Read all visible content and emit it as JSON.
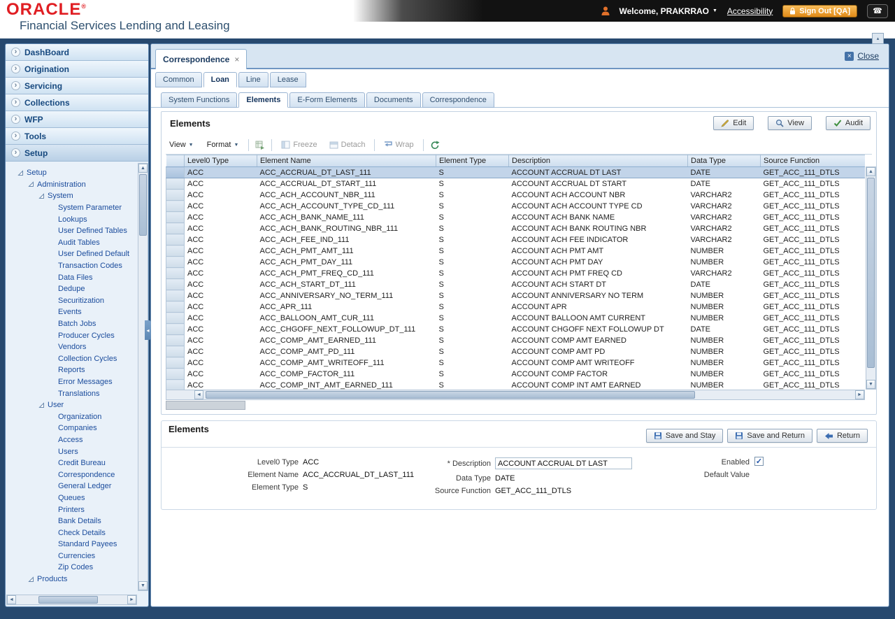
{
  "header": {
    "logo": "ORACLE",
    "logo_reg": "®",
    "product": "Financial Services Lending and Leasing",
    "welcome": "Welcome, PRAKRRAO",
    "accessibility": "Accessibility",
    "sign_out": "Sign Out [QA]"
  },
  "icons": {
    "caret_down": "▼",
    "chevron_right": "›",
    "close_x": "×",
    "phone": "☎",
    "check": "✓",
    "scroll_up": "▲",
    "scroll_down": "▼",
    "scroll_left": "◄",
    "scroll_right": "►",
    "collapse_left": "◂",
    "collapse_up": "▴"
  },
  "sidebar": {
    "nav": [
      {
        "label": "DashBoard",
        "selected": false
      },
      {
        "label": "Origination",
        "selected": false
      },
      {
        "label": "Servicing",
        "selected": false
      },
      {
        "label": "Collections",
        "selected": false
      },
      {
        "label": "WFP",
        "selected": false
      },
      {
        "label": "Tools",
        "selected": false
      },
      {
        "label": "Setup",
        "selected": true
      }
    ],
    "tree": [
      {
        "label": "Setup",
        "indent": 0,
        "expanded": true
      },
      {
        "label": "Administration",
        "indent": 1,
        "expanded": true
      },
      {
        "label": "System",
        "indent": 2,
        "expanded": true
      },
      {
        "label": "System Parameter",
        "indent": 3,
        "expanded": false
      },
      {
        "label": "Lookups",
        "indent": 3,
        "expanded": false
      },
      {
        "label": "User Defined Tables",
        "indent": 3,
        "expanded": false
      },
      {
        "label": "Audit Tables",
        "indent": 3,
        "expanded": false
      },
      {
        "label": "User Defined Default",
        "indent": 3,
        "expanded": false
      },
      {
        "label": "Transaction Codes",
        "indent": 3,
        "expanded": false
      },
      {
        "label": "Data Files",
        "indent": 3,
        "expanded": false
      },
      {
        "label": "Dedupe",
        "indent": 3,
        "expanded": false
      },
      {
        "label": "Securitization",
        "indent": 3,
        "expanded": false
      },
      {
        "label": "Events",
        "indent": 3,
        "expanded": false
      },
      {
        "label": "Batch Jobs",
        "indent": 3,
        "expanded": false
      },
      {
        "label": "Producer Cycles",
        "indent": 3,
        "expanded": false
      },
      {
        "label": "Vendors",
        "indent": 3,
        "expanded": false
      },
      {
        "label": "Collection Cycles",
        "indent": 3,
        "expanded": false
      },
      {
        "label": "Reports",
        "indent": 3,
        "expanded": false
      },
      {
        "label": "Error Messages",
        "indent": 3,
        "expanded": false
      },
      {
        "label": "Translations",
        "indent": 3,
        "expanded": false
      },
      {
        "label": "User",
        "indent": 2,
        "expanded": true
      },
      {
        "label": "Organization",
        "indent": 3,
        "expanded": false
      },
      {
        "label": "Companies",
        "indent": 3,
        "expanded": false
      },
      {
        "label": "Access",
        "indent": 3,
        "expanded": false
      },
      {
        "label": "Users",
        "indent": 3,
        "expanded": false
      },
      {
        "label": "Credit Bureau",
        "indent": 3,
        "expanded": false
      },
      {
        "label": "Correspondence",
        "indent": 3,
        "expanded": false
      },
      {
        "label": "General Ledger",
        "indent": 3,
        "expanded": false
      },
      {
        "label": "Queues",
        "indent": 3,
        "expanded": false
      },
      {
        "label": "Printers",
        "indent": 3,
        "expanded": false
      },
      {
        "label": "Bank Details",
        "indent": 3,
        "expanded": false
      },
      {
        "label": "Check Details",
        "indent": 3,
        "expanded": false
      },
      {
        "label": "Standard Payees",
        "indent": 3,
        "expanded": false
      },
      {
        "label": "Currencies",
        "indent": 3,
        "expanded": false
      },
      {
        "label": "Zip Codes",
        "indent": 3,
        "expanded": false
      },
      {
        "label": "Products",
        "indent": 1,
        "expanded": true
      }
    ]
  },
  "workspace": {
    "doc_tab": "Correspondence",
    "close_label": "Close",
    "tabs_level1": [
      {
        "label": "Common",
        "active": false
      },
      {
        "label": "Loan",
        "active": true
      },
      {
        "label": "Line",
        "active": false
      },
      {
        "label": "Lease",
        "active": false
      }
    ],
    "tabs_level2": [
      {
        "label": "System Functions",
        "active": false
      },
      {
        "label": "Elements",
        "active": true
      },
      {
        "label": "E-Form Elements",
        "active": false
      },
      {
        "label": "Documents",
        "active": false
      },
      {
        "label": "Correspondence",
        "active": false
      }
    ]
  },
  "elements_panel": {
    "title": "Elements",
    "actions": {
      "edit": "Edit",
      "view": "View",
      "audit": "Audit"
    },
    "toolbar": {
      "view": "View",
      "format": "Format",
      "freeze": "Freeze",
      "detach": "Detach",
      "wrap": "Wrap"
    },
    "table": {
      "columns": [
        "Level0 Type",
        "Element Name",
        "Element Type",
        "Description",
        "Data Type",
        "Source Function"
      ],
      "selected_row": 0,
      "rows": [
        [
          "ACC",
          "ACC_ACCRUAL_DT_LAST_111",
          "S",
          "ACCOUNT ACCRUAL DT LAST",
          "DATE",
          "GET_ACC_111_DTLS"
        ],
        [
          "ACC",
          "ACC_ACCRUAL_DT_START_111",
          "S",
          "ACCOUNT ACCRUAL DT START",
          "DATE",
          "GET_ACC_111_DTLS"
        ],
        [
          "ACC",
          "ACC_ACH_ACCOUNT_NBR_111",
          "S",
          "ACCOUNT ACH ACCOUNT NBR",
          "VARCHAR2",
          "GET_ACC_111_DTLS"
        ],
        [
          "ACC",
          "ACC_ACH_ACCOUNT_TYPE_CD_111",
          "S",
          "ACCOUNT ACH ACCOUNT TYPE CD",
          "VARCHAR2",
          "GET_ACC_111_DTLS"
        ],
        [
          "ACC",
          "ACC_ACH_BANK_NAME_111",
          "S",
          "ACCOUNT ACH BANK NAME",
          "VARCHAR2",
          "GET_ACC_111_DTLS"
        ],
        [
          "ACC",
          "ACC_ACH_BANK_ROUTING_NBR_111",
          "S",
          "ACCOUNT ACH BANK ROUTING NBR",
          "VARCHAR2",
          "GET_ACC_111_DTLS"
        ],
        [
          "ACC",
          "ACC_ACH_FEE_IND_111",
          "S",
          "ACCOUNT ACH FEE INDICATOR",
          "VARCHAR2",
          "GET_ACC_111_DTLS"
        ],
        [
          "ACC",
          "ACC_ACH_PMT_AMT_111",
          "S",
          "ACCOUNT ACH PMT AMT",
          "NUMBER",
          "GET_ACC_111_DTLS"
        ],
        [
          "ACC",
          "ACC_ACH_PMT_DAY_111",
          "S",
          "ACCOUNT ACH PMT DAY",
          "NUMBER",
          "GET_ACC_111_DTLS"
        ],
        [
          "ACC",
          "ACC_ACH_PMT_FREQ_CD_111",
          "S",
          "ACCOUNT ACH PMT FREQ CD",
          "VARCHAR2",
          "GET_ACC_111_DTLS"
        ],
        [
          "ACC",
          "ACC_ACH_START_DT_111",
          "S",
          "ACCOUNT ACH START DT",
          "DATE",
          "GET_ACC_111_DTLS"
        ],
        [
          "ACC",
          "ACC_ANNIVERSARY_NO_TERM_111",
          "S",
          "ACCOUNT ANNIVERSARY NO TERM",
          "NUMBER",
          "GET_ACC_111_DTLS"
        ],
        [
          "ACC",
          "ACC_APR_111",
          "S",
          "ACCOUNT APR",
          "NUMBER",
          "GET_ACC_111_DTLS"
        ],
        [
          "ACC",
          "ACC_BALLOON_AMT_CUR_111",
          "S",
          "ACCOUNT BALLOON AMT CURRENT",
          "NUMBER",
          "GET_ACC_111_DTLS"
        ],
        [
          "ACC",
          "ACC_CHGOFF_NEXT_FOLLOWUP_DT_111",
          "S",
          "ACCOUNT CHGOFF NEXT FOLLOWUP DT",
          "DATE",
          "GET_ACC_111_DTLS"
        ],
        [
          "ACC",
          "ACC_COMP_AMT_EARNED_111",
          "S",
          "ACCOUNT COMP AMT EARNED",
          "NUMBER",
          "GET_ACC_111_DTLS"
        ],
        [
          "ACC",
          "ACC_COMP_AMT_PD_111",
          "S",
          "ACCOUNT COMP AMT PD",
          "NUMBER",
          "GET_ACC_111_DTLS"
        ],
        [
          "ACC",
          "ACC_COMP_AMT_WRITEOFF_111",
          "S",
          "ACCOUNT COMP AMT WRITEOFF",
          "NUMBER",
          "GET_ACC_111_DTLS"
        ],
        [
          "ACC",
          "ACC_COMP_FACTOR_111",
          "S",
          "ACCOUNT COMP FACTOR",
          "NUMBER",
          "GET_ACC_111_DTLS"
        ],
        [
          "ACC",
          "ACC_COMP_INT_AMT_EARNED_111",
          "S",
          "ACCOUNT COMP INT AMT EARNED",
          "NUMBER",
          "GET_ACC_111_DTLS"
        ]
      ]
    }
  },
  "detail_panel": {
    "title": "Elements",
    "buttons": {
      "save_stay": "Save and Stay",
      "save_return": "Save and Return",
      "return": "Return"
    },
    "fields": {
      "level0_type_label": "Level0 Type",
      "level0_type": "ACC",
      "element_name_label": "Element Name",
      "element_name": "ACC_ACCRUAL_DT_LAST_111",
      "element_type_label": "Element Type",
      "element_type": "S",
      "description_label": "* Description",
      "description": "ACCOUNT ACCRUAL DT LAST",
      "data_type_label": "Data Type",
      "data_type": "DATE",
      "source_function_label": "Source Function",
      "source_function": "GET_ACC_111_DTLS",
      "enabled_label": "Enabled",
      "enabled": true,
      "default_value_label": "Default Value"
    }
  }
}
